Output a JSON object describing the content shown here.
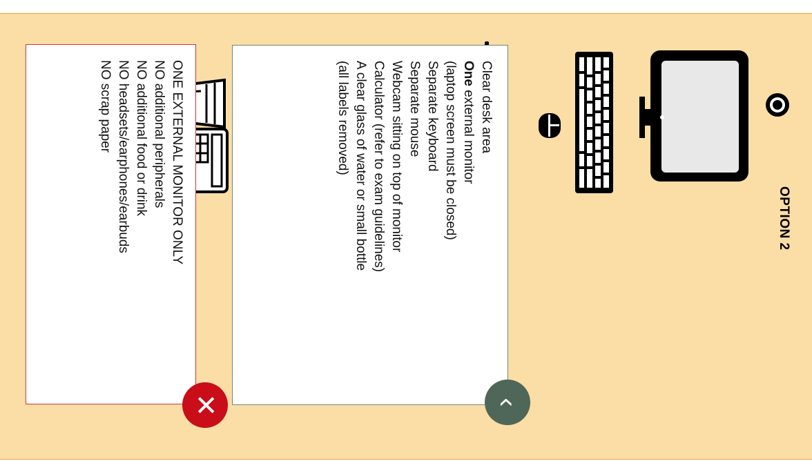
{
  "title": "OPTION 2",
  "allowed": {
    "items": [
      "Clear desk area",
      "external monitor",
      "(laptop screen must be closed)",
      "Separate keyboard",
      "Separate mouse",
      "Webcam sitting on top of monitor",
      "Calculator (refer to exam guidelines)",
      "A clear glass of water or small bottle",
      "(all labels removed)"
    ],
    "one_prefix": "One"
  },
  "not_allowed": {
    "heading": "ONE EXTERNAL MONITOR ONLY",
    "items": [
      "NO additional peripherals",
      "NO additional food or drink",
      "NO headsets/earphones/earbuds",
      "NO scrap paper"
    ]
  },
  "badges": {
    "back": "‹",
    "close": "✕"
  },
  "colors": {
    "panel_bg": "#fbdea6",
    "panel_border": "#e7a53a",
    "allowed_border": "#6f8676",
    "not_allowed_border": "#d63038",
    "back_badge": "#4f6758",
    "close_badge": "#c90d19"
  },
  "icons": [
    "webcam-icon",
    "monitor-icon",
    "keyboard-icon",
    "mouse-icon",
    "laptop-icon",
    "calculator-icon",
    "glass-icon"
  ]
}
